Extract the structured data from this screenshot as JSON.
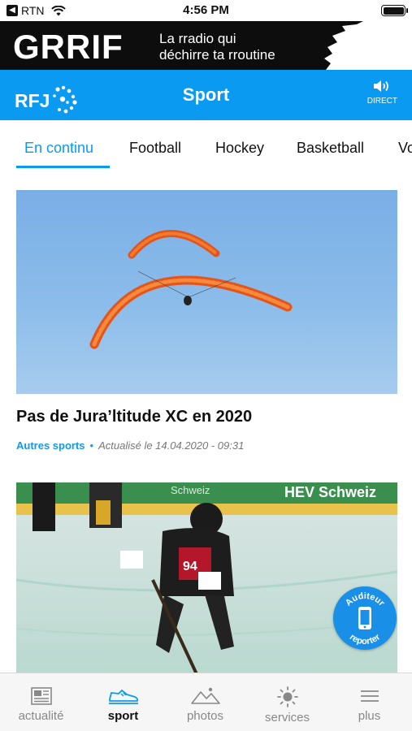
{
  "status_bar": {
    "carrier": "RTN",
    "time": "4:56 PM"
  },
  "ad": {
    "brand": "GRRIF",
    "line1": "La rradio qui",
    "line2": "déchirre ta rroutine"
  },
  "header": {
    "logo_text": "RFJ",
    "title": "Sport",
    "direct_label": "DIRECT"
  },
  "tabs": [
    {
      "label": "En continu",
      "active": true
    },
    {
      "label": "Football",
      "active": false
    },
    {
      "label": "Hockey",
      "active": false
    },
    {
      "label": "Basketball",
      "active": false
    },
    {
      "label": "Vo",
      "active": false
    }
  ],
  "articles": [
    {
      "title": "Pas de Jura’ltitude XC en 2020",
      "category": "Autres sports",
      "separator": "•",
      "date": "Actualisé le 14.04.2020 - 09:31"
    },
    {
      "board_text_1": "Schweiz",
      "board_text_2": "HEV Schweiz",
      "jersey_number": "94"
    }
  ],
  "reporter_button": {
    "line1": "Auditeur",
    "line2": "reporter"
  },
  "bottom_nav": [
    {
      "label": "actualité",
      "icon": "newspaper-icon",
      "active": false
    },
    {
      "label": "sport",
      "icon": "sneaker-icon",
      "active": true
    },
    {
      "label": "photos",
      "icon": "mountain-icon",
      "active": false
    },
    {
      "label": "services",
      "icon": "sun-icon",
      "active": false
    },
    {
      "label": "plus",
      "icon": "menu-icon",
      "active": false
    }
  ],
  "colors": {
    "accent": "#0a9af2",
    "ad_background": "#0d0d0d"
  }
}
